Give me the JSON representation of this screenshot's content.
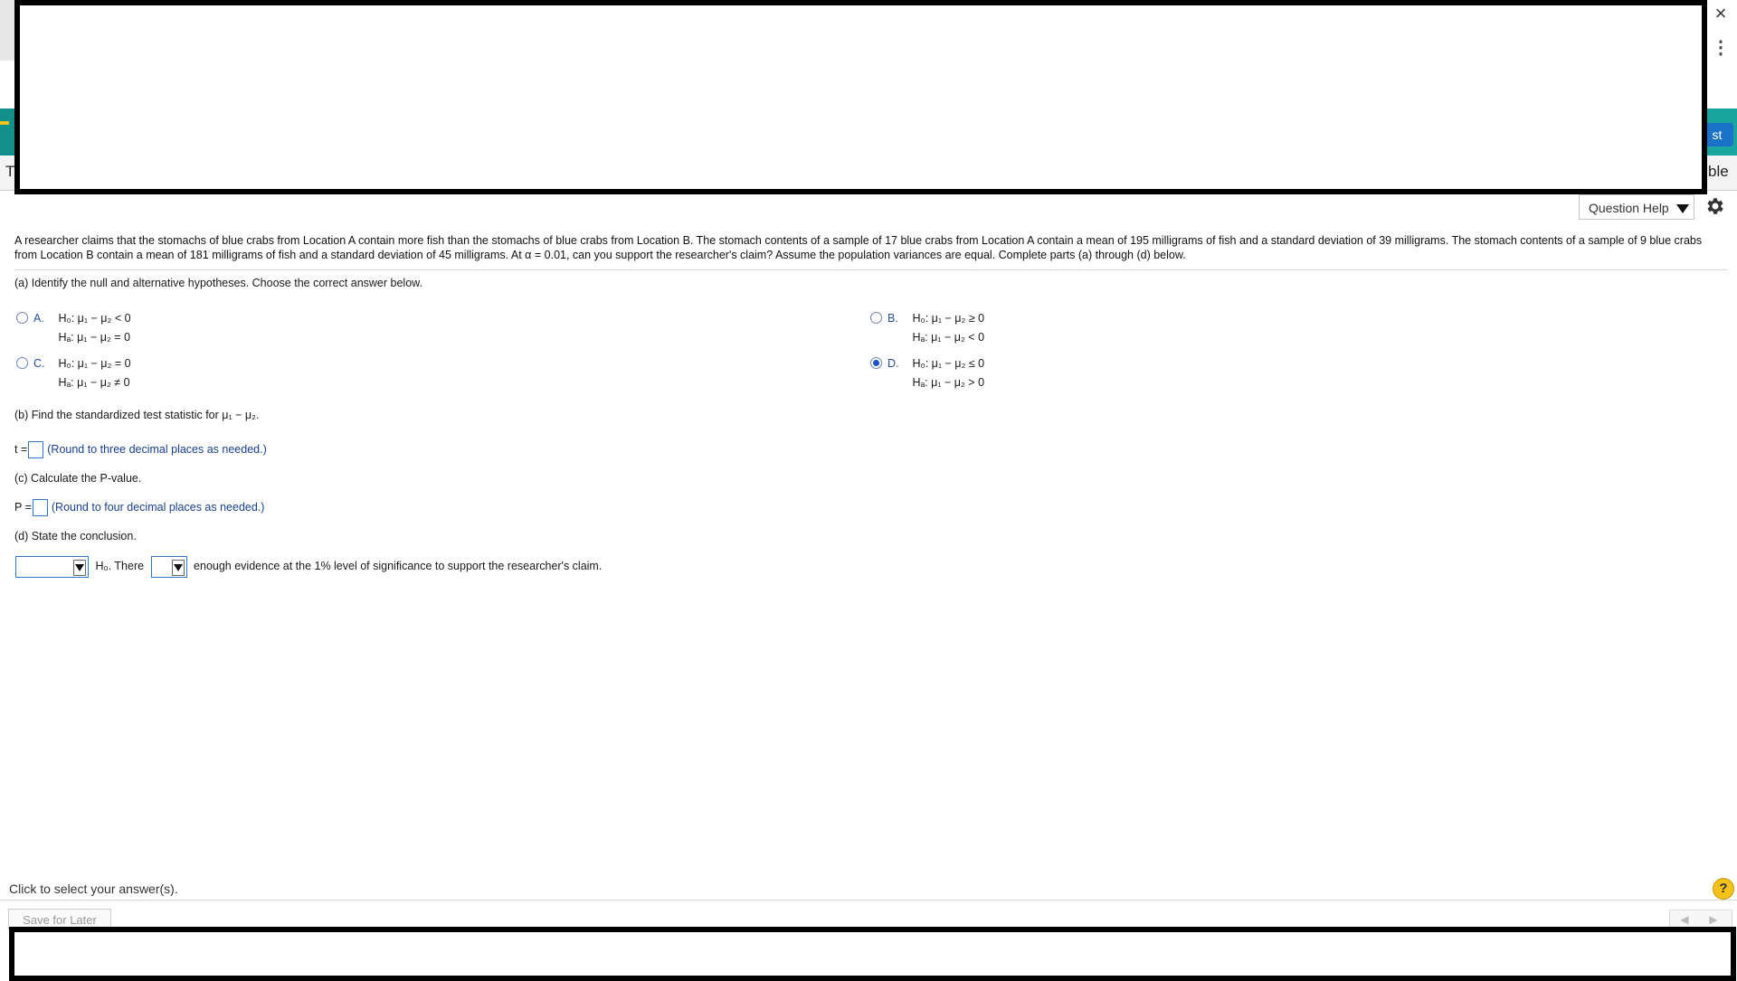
{
  "chrome": {
    "close_icon": "×",
    "kebab_icon": "⋮",
    "partial_button": "st",
    "partial_text_right": "ble",
    "partial_text_left": "T"
  },
  "toolbar": {
    "question_help": "Question Help"
  },
  "problem": {
    "text": "A researcher claims that the stomachs of blue crabs from Location A contain more fish than the stomachs of blue crabs from Location B. The stomach contents of a sample of 17 blue crabs from Location A contain a mean of 195 milligrams of fish and a standard deviation of 39 milligrams. The stomach contents of a sample of 9 blue crabs from Location B contain a mean of 181 milligrams of fish and a standard deviation of 45 milligrams. At α = 0.01, can you support the researcher's claim? Assume the population variances are equal. Complete parts (a) through (d) below."
  },
  "part_a": {
    "prompt": "(a) Identify the null and alternative hypotheses. Choose the correct answer below.",
    "options": [
      {
        "letter": "A.",
        "h0": "H₀: μ₁ − μ₂ < 0",
        "ha": "Hₐ: μ₁ − μ₂ = 0",
        "selected": false
      },
      {
        "letter": "B.",
        "h0": "H₀: μ₁ − μ₂ ≥ 0",
        "ha": "Hₐ: μ₁ − μ₂ < 0",
        "selected": false
      },
      {
        "letter": "C.",
        "h0": "H₀: μ₁ − μ₂ = 0",
        "ha": "Hₐ: μ₁ − μ₂ ≠ 0",
        "selected": false
      },
      {
        "letter": "D.",
        "h0": "H₀: μ₁ − μ₂ ≤ 0",
        "ha": "Hₐ: μ₁ − μ₂ > 0",
        "selected": true
      }
    ]
  },
  "part_b": {
    "prompt": "(b) Find the standardized test statistic for μ₁ − μ₂.",
    "label": "t =",
    "value": "",
    "hint": "(Round to three decimal places as needed.)"
  },
  "part_c": {
    "prompt": "(c) Calculate the P-value.",
    "label": "P =",
    "value": "",
    "hint": "(Round to four decimal places as needed.)"
  },
  "part_d": {
    "prompt": "(d) State the conclusion.",
    "select1_value": "",
    "h0_text": "H₀. There",
    "select2_value": "",
    "tail_text": "enough evidence at the 1% level of significance to support the researcher's claim."
  },
  "footer": {
    "status": "Click to select your answer(s).",
    "help_icon": "?",
    "save_later": "Save for Later",
    "prev_icon": "◀",
    "next_icon": "▶"
  }
}
